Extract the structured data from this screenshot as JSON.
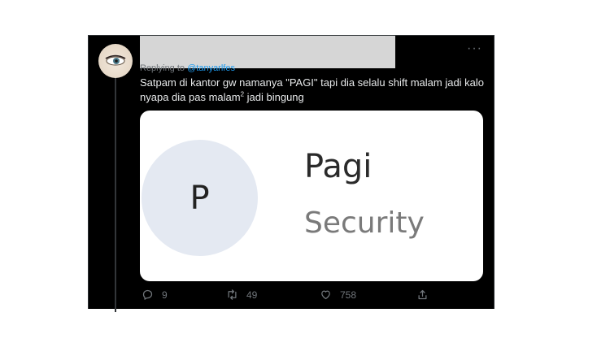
{
  "tweet": {
    "replying_prefix": "Replying to",
    "replying_handle": "@tanyarlfes",
    "text_main": "Satpam di kantor gw namanya \"PAGI\" tapi dia selalu shift malam jadi kalo nyapa dia pas malam",
    "text_sup": "2",
    "text_end": " jadi bingung",
    "more_glyph": "···"
  },
  "media": {
    "avatar_letter": "P",
    "name": "Pagi",
    "role": "Security"
  },
  "actions": {
    "reply_count": "9",
    "retweet_count": "49",
    "like_count": "758"
  },
  "icons": {
    "reply": "reply-icon",
    "retweet": "retweet-icon",
    "like": "heart-icon",
    "share": "share-icon",
    "more": "more-icon"
  },
  "colors": {
    "background": "#000000",
    "text": "#e7e9ea",
    "muted": "#71767b",
    "link": "#1d9bf0"
  }
}
